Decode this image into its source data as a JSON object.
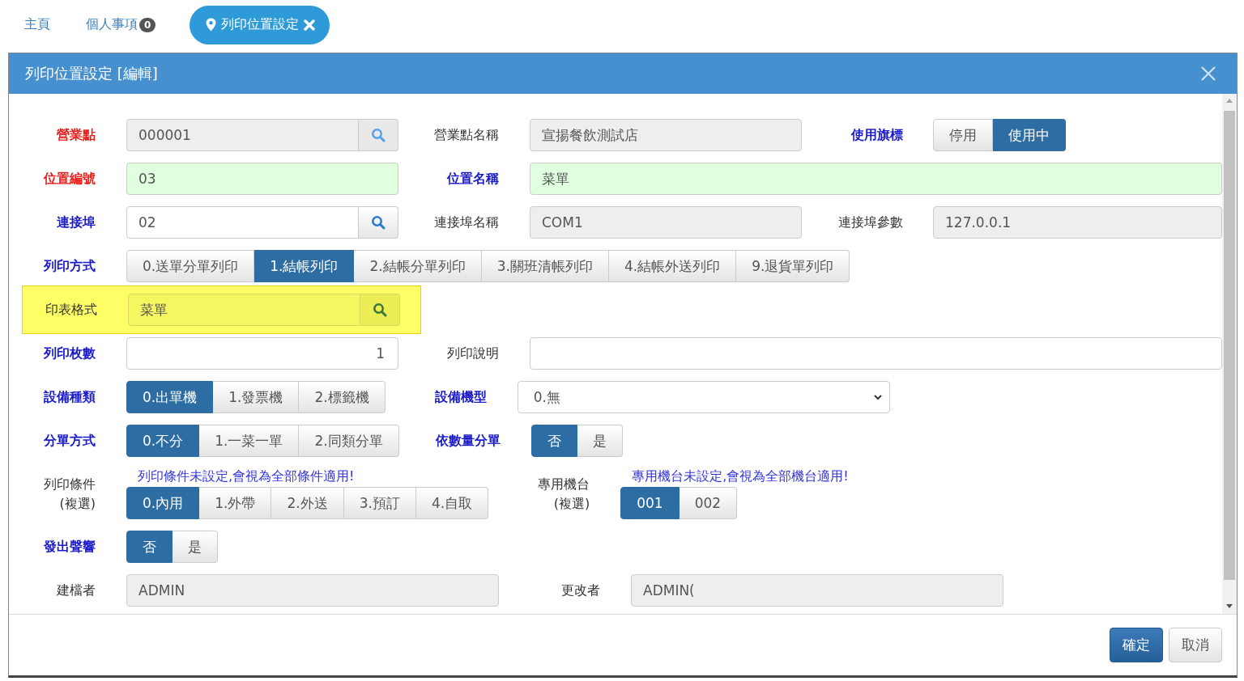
{
  "tabs": [
    {
      "label": "主頁",
      "selected": false
    },
    {
      "label": "個人事項",
      "badge": "0",
      "selected": false
    },
    {
      "label": "列印位置設定",
      "selected": true
    }
  ],
  "dialog": {
    "title": "列印位置設定 [編輯]",
    "rows": [
      {
        "kind": "triple",
        "highlighted": false,
        "cells": [
          {
            "label": "營業點",
            "color": "#e8201c",
            "control": {
              "kind": "lookup",
              "value": "000001",
              "readonly": true,
              "valid": false
            }
          },
          {
            "label": "營業點名稱",
            "color": "#333333",
            "control": {
              "kind": "text",
              "value": "宣揚餐飲測試店",
              "readonly": true,
              "valid": false
            }
          },
          {
            "label": "使用旗標",
            "color": "#1a1acc",
            "control": {
              "kind": "choice",
              "options": [
                {
                  "label": "停用",
                  "selected": false
                },
                {
                  "label": "使用中",
                  "selected": true
                }
              ]
            }
          }
        ]
      },
      {
        "kind": "triple",
        "highlighted": false,
        "cells": [
          {
            "label": "位置編號",
            "color": "#e8201c",
            "control": {
              "kind": "text",
              "value": "03",
              "readonly": false,
              "valid": true
            }
          },
          {
            "label": "位置名稱",
            "color": "#1a1acc",
            "control": {
              "kind": "text",
              "value": "菜單",
              "readonly": false,
              "valid": true
            }
          }
        ]
      },
      {
        "kind": "triple",
        "highlighted": false,
        "cells": [
          {
            "label": "連接埠",
            "color": "#1a1acc",
            "control": {
              "kind": "lookup",
              "value": "02",
              "readonly": false,
              "valid": false
            }
          },
          {
            "label": "連接埠名稱",
            "color": "#333333",
            "control": {
              "kind": "text",
              "value": "COM1",
              "readonly": true,
              "valid": false
            }
          },
          {
            "label": "連接埠參數",
            "color": "#333333",
            "control": {
              "kind": "text",
              "value": "127.0.0.1",
              "readonly": true,
              "valid": false
            }
          }
        ]
      },
      {
        "kind": "triple",
        "highlighted": false,
        "cells": [
          {
            "label": "列印方式",
            "color": "#1a1acc",
            "control": {
              "kind": "choice",
              "options": [
                {
                  "label": "0.送單分單列印",
                  "selected": false
                },
                {
                  "label": "1.結帳列印",
                  "selected": true
                },
                {
                  "label": "2.結帳分單列印",
                  "selected": false
                },
                {
                  "label": "3.關班清帳列印",
                  "selected": false
                },
                {
                  "label": "4.結帳外送列印",
                  "selected": false
                },
                {
                  "label": "9.退貨單列印",
                  "selected": false
                }
              ]
            }
          }
        ]
      },
      {
        "kind": "triple",
        "highlighted": true,
        "cells": [
          {
            "label": "印表格式",
            "color": "#333333",
            "control": {
              "kind": "lookup",
              "value": "菜單",
              "readonly": false,
              "valid": false
            }
          }
        ]
      },
      {
        "kind": "triple",
        "highlighted": false,
        "cells": [
          {
            "label": "列印枚數",
            "color": "#1a1acc",
            "control": {
              "kind": "number",
              "value": "1",
              "readonly": false,
              "valid": false
            }
          },
          {
            "label": "列印說明",
            "color": "#333333",
            "control": {
              "kind": "text",
              "readonly": false,
              "valid": false
            }
          }
        ]
      },
      {
        "kind": "double",
        "highlighted": false,
        "cells": [
          {
            "label": "設備種類",
            "color": "#1a1acc",
            "control": {
              "kind": "choice",
              "options": [
                {
                  "label": "0.出單機",
                  "selected": true
                },
                {
                  "label": "1.發票機",
                  "selected": false
                },
                {
                  "label": "2.標籤機",
                  "selected": false
                }
              ]
            }
          },
          {
            "label": "設備機型",
            "color": "#1a1acc",
            "control": {
              "kind": "select",
              "value": "0.無"
            }
          }
        ]
      },
      {
        "kind": "double",
        "highlighted": false,
        "cells": [
          {
            "label": "分單方式",
            "color": "#1a1acc",
            "control": {
              "kind": "choice",
              "options": [
                {
                  "label": "0.不分",
                  "selected": true
                },
                {
                  "label": "1.一菜一單",
                  "selected": false
                },
                {
                  "label": "2.同類分單",
                  "selected": false
                }
              ]
            }
          },
          {
            "label": "依數量分單",
            "color": "#1a1acc",
            "control": {
              "kind": "choice",
              "options": [
                {
                  "label": "否",
                  "selected": true
                },
                {
                  "label": "是",
                  "selected": false
                }
              ]
            }
          }
        ]
      },
      {
        "kind": "double",
        "highlighted": false,
        "cells": [
          {
            "label": "列印條件",
            "sublabel": "(複選)",
            "color": "#333333",
            "hint": "列印條件未設定,會視為全部條件適用!",
            "control": {
              "kind": "choice",
              "options": [
                {
                  "label": "0.內用",
                  "selected": true
                },
                {
                  "label": "1.外帶",
                  "selected": false
                },
                {
                  "label": "2.外送",
                  "selected": false
                },
                {
                  "label": "3.預訂",
                  "selected": false
                },
                {
                  "label": "4.自取",
                  "selected": false
                }
              ]
            }
          },
          {
            "label": "專用機台",
            "sublabel": "(複選)",
            "color": "#333333",
            "hint": "專用機台未設定,會視為全部機台適用!",
            "control": {
              "kind": "choice",
              "options": [
                {
                  "label": "001",
                  "selected": true
                },
                {
                  "label": "002",
                  "selected": false
                }
              ]
            }
          }
        ]
      },
      {
        "kind": "double",
        "highlighted": false,
        "cells": [
          {
            "label": "發出聲響",
            "color": "#1a1acc",
            "control": {
              "kind": "choice",
              "options": [
                {
                  "label": "否",
                  "selected": true
                },
                {
                  "label": "是",
                  "selected": false
                }
              ]
            }
          }
        ]
      },
      {
        "kind": "double",
        "highlighted": false,
        "cells": [
          {
            "label": "建檔者",
            "color": "#333333",
            "control": {
              "kind": "text",
              "value": "ADMIN",
              "readonly": true,
              "valid": false
            }
          },
          {
            "label": "更改者",
            "color": "#333333",
            "control": {
              "kind": "text",
              "value": "ADMIN(",
              "readonly": true,
              "valid": false
            }
          }
        ]
      }
    ],
    "buttons": [
      {
        "label": "確定",
        "kind": "primary"
      },
      {
        "label": "取消",
        "kind": "default"
      }
    ]
  }
}
